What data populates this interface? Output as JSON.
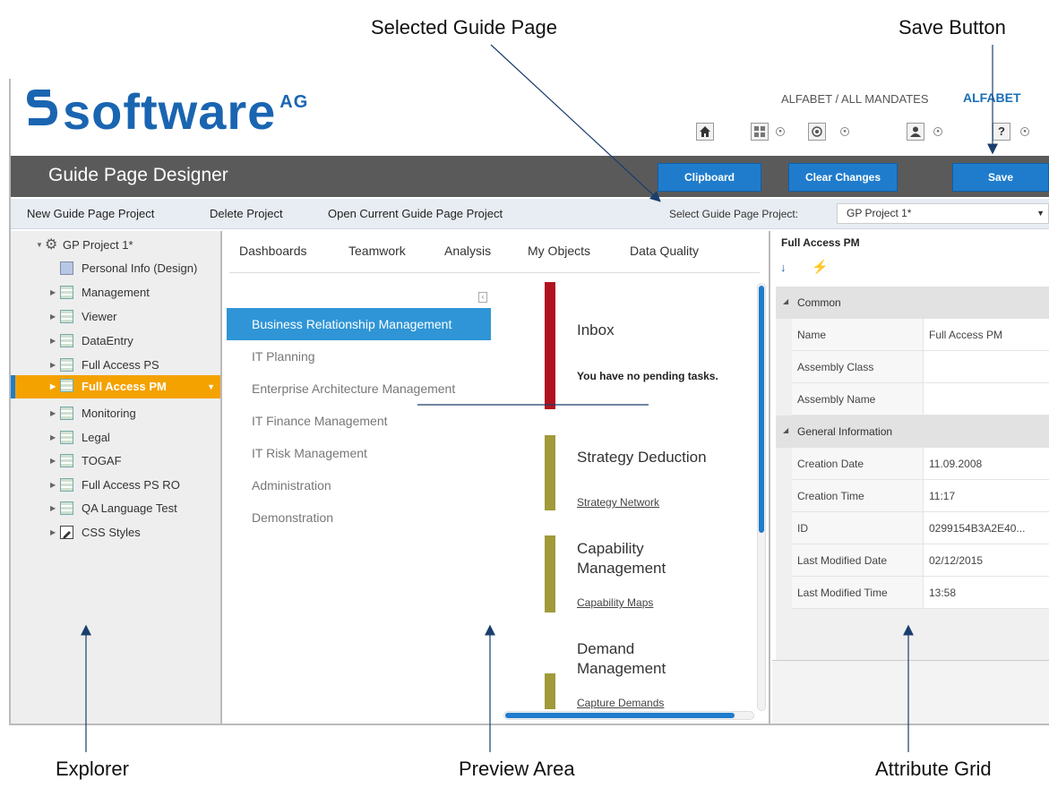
{
  "callouts": {
    "selected_guide_page": "Selected Guide Page",
    "save_button": "Save Button",
    "explorer": "Explorer",
    "preview_area": "Preview Area",
    "attribute_grid": "Attribute Grid"
  },
  "header": {
    "logo_text": "software",
    "logo_suffix": "AG",
    "mandates": "ALFABET / ALL MANDATES",
    "alfabet_logo": "ALFABET",
    "icons": [
      "home-icon",
      "grid-icon",
      "network-icon",
      "user-icon",
      "help-icon"
    ],
    "help_glyph": "?"
  },
  "titlebar": {
    "title": "Guide Page Designer",
    "clipboard_label": "Clipboard",
    "clear_changes_label": "Clear Changes",
    "save_label": "Save"
  },
  "menubar": {
    "new_project": "New Guide Page Project",
    "delete_project": "Delete Project",
    "open_current": "Open Current Guide Page Project",
    "select_label": "Select Guide Page Project:",
    "select_value": "GP Project 1*"
  },
  "explorer": {
    "root": "GP Project 1*",
    "items": [
      "Personal Info (Design)",
      "Management",
      "Viewer",
      "DataEntry",
      "Full Access PS",
      "Full Access PM",
      "Monitoring",
      "Legal",
      "TOGAF",
      "Full Access PS RO",
      "QA Language Test",
      "CSS Styles"
    ],
    "selected_item": "Full Access PM"
  },
  "preview": {
    "tabs": [
      "Dashboards",
      "Teamwork",
      "Analysis",
      "My Objects",
      "Data Quality"
    ],
    "nav": [
      "Business Relationship Management",
      "IT Planning",
      "Enterprise Architecture Management",
      "IT Finance Management",
      "IT Risk Management",
      "Administration",
      "Demonstration"
    ],
    "widgets": {
      "inbox_title": "Inbox",
      "inbox_text": "You have no pending tasks.",
      "strategy_title": "Strategy Deduction",
      "strategy_link": "Strategy Network",
      "capability_title_1": "Capability",
      "capability_title_2": "Management",
      "capability_link": "Capability Maps",
      "demand_title_1": "Demand",
      "demand_title_2": "Management",
      "demand_link": "Capture Demands"
    },
    "colors": {
      "inbox_bar": "#b1121f",
      "widget_bar": "#a09a3a",
      "active_nav": "#2f95d6"
    }
  },
  "attributes": {
    "header": "Full Access PM",
    "sections": {
      "common": "Common",
      "general": "General Information"
    },
    "rows": [
      {
        "key": "Name",
        "value": "Full Access PM"
      },
      {
        "key": "Assembly Class",
        "value": ""
      },
      {
        "key": "Assembly Name",
        "value": ""
      },
      {
        "key": "Creation Date",
        "value": "11.09.2008"
      },
      {
        "key": "Creation Time",
        "value": "11:17"
      },
      {
        "key": "ID",
        "value": "0299154B3A2E40..."
      },
      {
        "key": "Last Modified Date",
        "value": "02/12/2015"
      },
      {
        "key": "Last Modified Time",
        "value": "13:58"
      }
    ]
  },
  "colors": {
    "brand_blue": "#1a65b1",
    "button_blue": "#1f7ccc",
    "titlebar_gray": "#5a5a5a",
    "selected_orange": "#f4a200"
  }
}
